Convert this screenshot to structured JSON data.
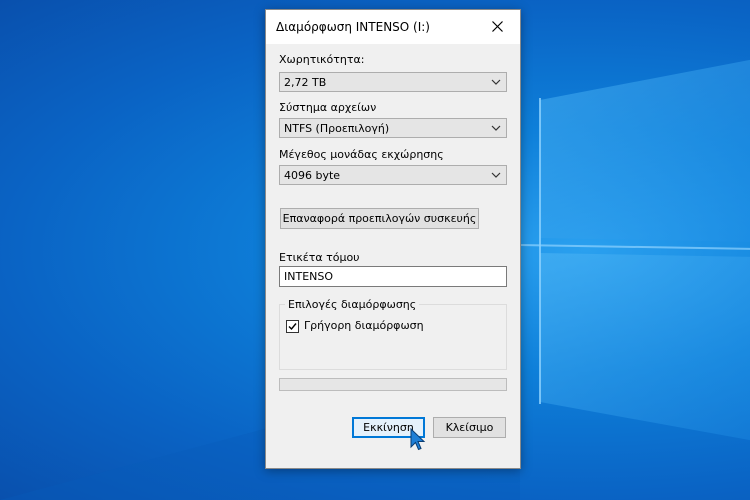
{
  "dialog": {
    "title": "Διαμόρφωση INTENSO (I:)",
    "capacity": {
      "label": "Χωρητικότητα:",
      "value": "2,72 TB"
    },
    "filesystem": {
      "label": "Σύστημα αρχείων",
      "value": "NTFS  (Προεπιλογή)"
    },
    "allocation": {
      "label": "Μέγεθος μονάδας εκχώρησης",
      "value": "4096 byte"
    },
    "restore_button": "Επαναφορά προεπιλογών συσκευής",
    "volume_label": {
      "label": "Ετικέτα τόμου",
      "value": "INTENSO"
    },
    "format_options": {
      "label": "Επιλογές διαμόρφωσης",
      "quick_format": {
        "label": "Γρήγορη διαμόρφωση",
        "checked": true
      }
    },
    "progress": {
      "fraction": 0
    },
    "start_button": "Εκκίνηση",
    "close_button": "Κλείσιμο"
  },
  "icons": {
    "close": "close-icon",
    "dropdown": "chevron-down-icon",
    "check": "checkmark-icon",
    "cursor": "mouse-pointer-icon"
  },
  "colors": {
    "desktop": "#0a63c4",
    "accent": "#0078d7",
    "progress": "#06b025"
  }
}
